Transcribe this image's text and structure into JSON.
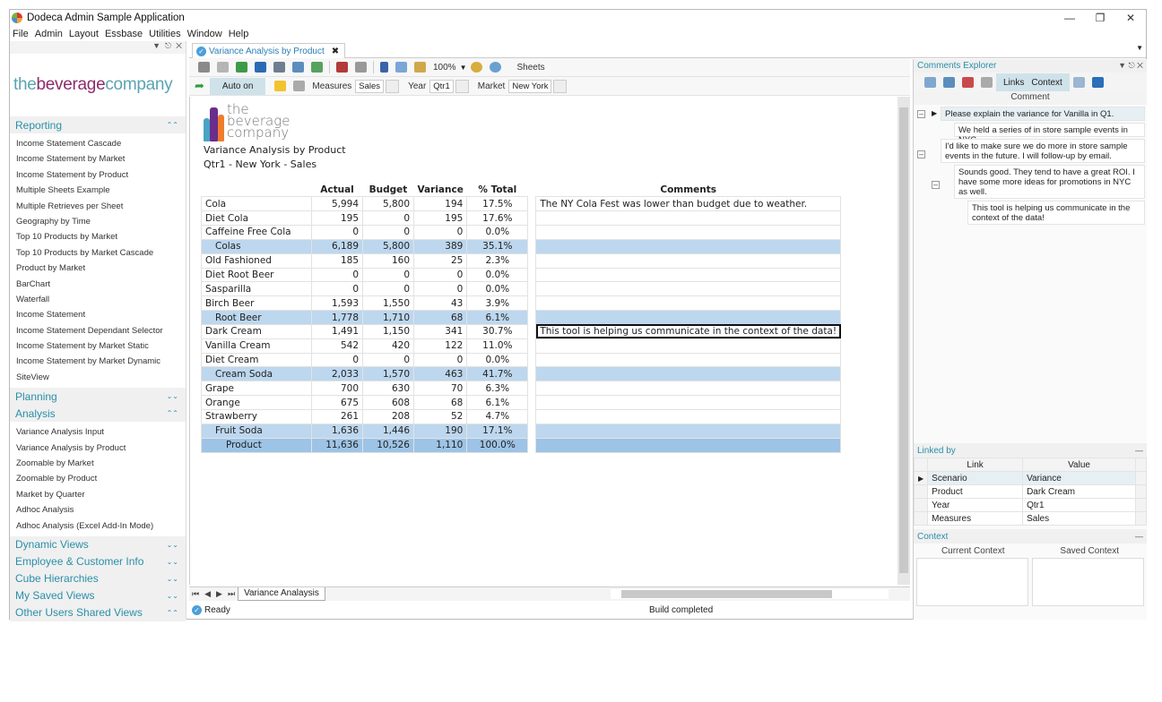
{
  "window": {
    "title": "Dodeca Admin Sample Application",
    "controls": [
      "minimize",
      "restore",
      "close"
    ]
  },
  "menu": [
    "File",
    "Admin",
    "Layout",
    "Essbase",
    "Utilities",
    "Window",
    "Help"
  ],
  "sidebar": {
    "logo": {
      "part1": "the",
      "part2": "beverage",
      "part3": "company"
    },
    "sections": [
      {
        "label": "Reporting",
        "expanded": true,
        "items": [
          "Income Statement Cascade",
          "Income Statement by Market",
          "Income Statement by Product",
          "Multiple Sheets Example",
          "Multiple Retrieves per Sheet",
          "Geography by Time",
          "Top 10 Products by Market",
          "Top 10 Products by Market Cascade",
          "Product by Market",
          "BarChart",
          "Waterfall",
          "Income Statement",
          "Income Statement Dependant Selector",
          "Income Statement by Market Static",
          "Income Statement by Market Dynamic",
          "SiteView"
        ]
      },
      {
        "label": "Planning",
        "expanded": false,
        "items": []
      },
      {
        "label": "Analysis",
        "expanded": true,
        "items": [
          "Variance Analysis Input",
          "Variance Analysis by Product",
          "Zoomable by Market",
          "Zoomable by Product",
          "Market by Quarter",
          "Adhoc Analysis",
          "Adhoc Analysis (Excel Add-In Mode)"
        ]
      },
      {
        "label": "Dynamic Views",
        "expanded": false,
        "items": []
      },
      {
        "label": "Employee & Customer Info",
        "expanded": false,
        "items": []
      },
      {
        "label": "Cube Hierarchies",
        "expanded": false,
        "items": []
      },
      {
        "label": "My Saved Views",
        "expanded": false,
        "items": []
      },
      {
        "label": "Other Users Shared Views",
        "expanded": true,
        "items": []
      }
    ]
  },
  "doc_tab": {
    "label": "Variance Analysis by Product"
  },
  "toolbar": {
    "zoom": "100%",
    "sheets_label": "Sheets",
    "auto_label": "Auto on",
    "selectors": [
      {
        "label": "Measures",
        "value": "Sales"
      },
      {
        "label": "Year",
        "value": "Qtr1"
      },
      {
        "label": "Market",
        "value": "New York"
      }
    ]
  },
  "report": {
    "logo": [
      "the",
      "beverage",
      "company"
    ],
    "title": "Variance Analysis by Product",
    "subtitle": "Qtr1 - New York - Sales",
    "headers": [
      "Actual",
      "Budget",
      "Variance",
      "% Total",
      "Comments"
    ],
    "rows": [
      {
        "name": "Cola",
        "actual": "5,994",
        "budget": "5,800",
        "variance": "194",
        "pct": "17.5%",
        "comment": "The NY Cola Fest was lower than budget due to weather.",
        "type": "item"
      },
      {
        "name": "Diet Cola",
        "actual": "195",
        "budget": "0",
        "variance": "195",
        "pct": "17.6%",
        "comment": "",
        "type": "item"
      },
      {
        "name": "Caffeine Free Cola",
        "actual": "0",
        "budget": "0",
        "variance": "0",
        "pct": "0.0%",
        "comment": "",
        "type": "item"
      },
      {
        "name": "Colas",
        "actual": "6,189",
        "budget": "5,800",
        "variance": "389",
        "pct": "35.1%",
        "comment": "",
        "type": "sub"
      },
      {
        "name": "Old Fashioned",
        "actual": "185",
        "budget": "160",
        "variance": "25",
        "pct": "2.3%",
        "comment": "",
        "type": "item"
      },
      {
        "name": "Diet Root Beer",
        "actual": "0",
        "budget": "0",
        "variance": "0",
        "pct": "0.0%",
        "comment": "",
        "type": "item"
      },
      {
        "name": "Sasparilla",
        "actual": "0",
        "budget": "0",
        "variance": "0",
        "pct": "0.0%",
        "comment": "",
        "type": "item"
      },
      {
        "name": "Birch Beer",
        "actual": "1,593",
        "budget": "1,550",
        "variance": "43",
        "pct": "3.9%",
        "comment": "",
        "type": "item"
      },
      {
        "name": "Root Beer",
        "actual": "1,778",
        "budget": "1,710",
        "variance": "68",
        "pct": "6.1%",
        "comment": "",
        "type": "sub"
      },
      {
        "name": "Dark Cream",
        "actual": "1,491",
        "budget": "1,150",
        "variance": "341",
        "pct": "30.7%",
        "comment": "This tool is helping us communicate in the context of the data!",
        "type": "item",
        "selected": true
      },
      {
        "name": "Vanilla Cream",
        "actual": "542",
        "budget": "420",
        "variance": "122",
        "pct": "11.0%",
        "comment": "",
        "type": "item"
      },
      {
        "name": "Diet Cream",
        "actual": "0",
        "budget": "0",
        "variance": "0",
        "pct": "0.0%",
        "comment": "",
        "type": "item"
      },
      {
        "name": "Cream Soda",
        "actual": "2,033",
        "budget": "1,570",
        "variance": "463",
        "pct": "41.7%",
        "comment": "",
        "type": "sub"
      },
      {
        "name": "Grape",
        "actual": "700",
        "budget": "630",
        "variance": "70",
        "pct": "6.3%",
        "comment": "",
        "type": "item"
      },
      {
        "name": "Orange",
        "actual": "675",
        "budget": "608",
        "variance": "68",
        "pct": "6.1%",
        "comment": "",
        "type": "item"
      },
      {
        "name": "Strawberry",
        "actual": "261",
        "budget": "208",
        "variance": "52",
        "pct": "4.7%",
        "comment": "",
        "type": "item"
      },
      {
        "name": "Fruit Soda",
        "actual": "1,636",
        "budget": "1,446",
        "variance": "190",
        "pct": "17.1%",
        "comment": "",
        "type": "sub"
      },
      {
        "name": "Product",
        "actual": "11,636",
        "budget": "10,526",
        "variance": "1,110",
        "pct": "100.0%",
        "comment": "",
        "type": "tot"
      }
    ]
  },
  "sheet_tab": "Variance Analaysis",
  "status": {
    "left": "Ready",
    "right": "Build completed"
  },
  "comments_explorer": {
    "title": "Comments Explorer",
    "links_label": "Links",
    "context_label": "Context",
    "column": "Comment",
    "comments": [
      "Please explain the variance for Vanilla in Q1.",
      "We held a series of in store sample events in NYC.",
      "I'd like to make sure we do more in store sample events in the future. I will follow-up by email.",
      "Sounds good. They tend to have a great ROI. I have some more ideas for promotions in NYC as well.",
      "This tool is helping us communicate in the context of the data!"
    ]
  },
  "linked_by": {
    "title": "Linked by",
    "headers": [
      "Link",
      "Value"
    ],
    "rows": [
      [
        "Scenario",
        "Variance"
      ],
      [
        "Product",
        "Dark Cream"
      ],
      [
        "Year",
        "Qtr1"
      ],
      [
        "Measures",
        "Sales"
      ]
    ]
  },
  "context": {
    "title": "Context",
    "current": "Current Context",
    "saved": "Saved Context"
  }
}
